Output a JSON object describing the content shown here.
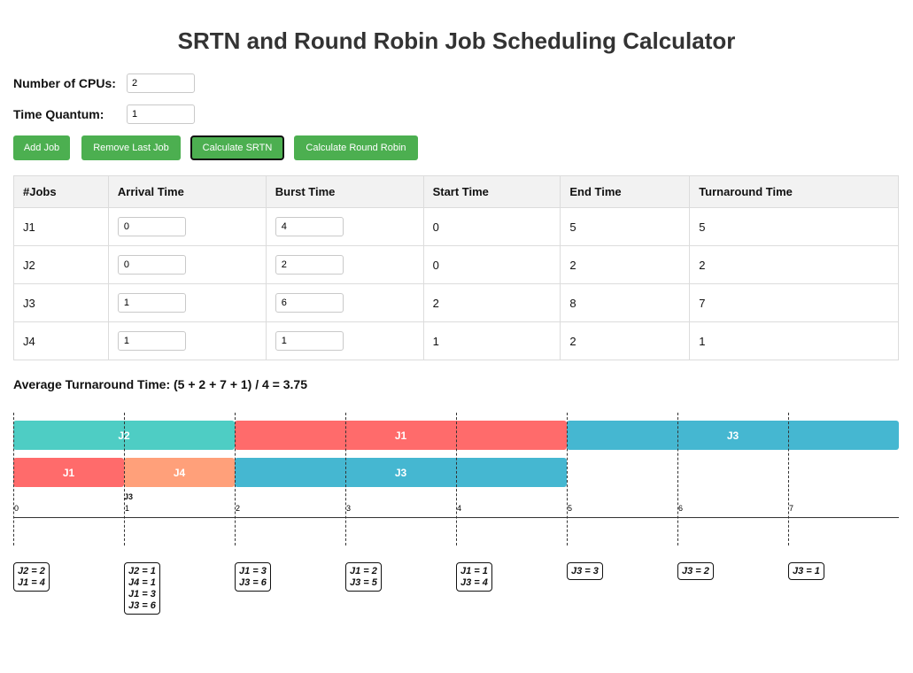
{
  "title": "SRTN and Round Robin Job Scheduling Calculator",
  "settings": {
    "cpus_label": "Number of CPUs:",
    "cpus_value": "2",
    "quantum_label": "Time Quantum:",
    "quantum_value": "1"
  },
  "buttons": {
    "add": "Add Job",
    "remove": "Remove Last Job",
    "srtn": "Calculate SRTN",
    "rr": "Calculate Round Robin"
  },
  "table": {
    "headers": [
      "#Jobs",
      "Arrival Time",
      "Burst Time",
      "Start Time",
      "End Time",
      "Turnaround Time"
    ],
    "rows": [
      {
        "job": "J1",
        "arrival": "0",
        "burst": "4",
        "start": "0",
        "end": "5",
        "turnaround": "5"
      },
      {
        "job": "J2",
        "arrival": "0",
        "burst": "2",
        "start": "0",
        "end": "2",
        "turnaround": "2"
      },
      {
        "job": "J3",
        "arrival": "1",
        "burst": "6",
        "start": "2",
        "end": "8",
        "turnaround": "7"
      },
      {
        "job": "J4",
        "arrival": "1",
        "burst": "1",
        "start": "1",
        "end": "2",
        "turnaround": "1"
      }
    ]
  },
  "average": "Average Turnaround Time: (5 + 2 + 7 + 1) / 4 = 3.75",
  "gantt": {
    "colors": {
      "J1": "#ff6b6b",
      "J2": "#4ecdc4",
      "J3": "#45b7d1",
      "J4": "#ffa07a"
    },
    "cpu1": [
      {
        "job": "J2",
        "start": 0,
        "end": 2
      },
      {
        "job": "J1",
        "start": 2,
        "end": 5
      },
      {
        "job": "J3",
        "start": 5,
        "end": 8
      }
    ],
    "cpu2": [
      {
        "job": "J1",
        "start": 0,
        "end": 1
      },
      {
        "job": "J4",
        "start": 1,
        "end": 2
      },
      {
        "job": "J3",
        "start": 2,
        "end": 5
      }
    ],
    "ticks": [
      "0",
      "1",
      "2",
      "3",
      "4",
      "5",
      "6",
      "7"
    ],
    "arrival_marker": {
      "time": "1",
      "label": "J3"
    },
    "ready_queues": [
      {
        "time": 0,
        "lines": [
          "J2 = 2",
          "J1 = 4"
        ]
      },
      {
        "time": 1,
        "lines": [
          "J2 = 1",
          "J4 = 1",
          "J1 = 3",
          "J3 = 6"
        ]
      },
      {
        "time": 2,
        "lines": [
          "J1 = 3",
          "J3 = 6"
        ]
      },
      {
        "time": 3,
        "lines": [
          "J1 = 2",
          "J3 = 5"
        ]
      },
      {
        "time": 4,
        "lines": [
          "J1 = 1",
          "J3 = 4"
        ]
      },
      {
        "time": 5,
        "lines": [
          "J3 = 3"
        ]
      },
      {
        "time": 6,
        "lines": [
          "J3 = 2"
        ]
      },
      {
        "time": 7,
        "lines": [
          "J3 = 1"
        ]
      }
    ]
  }
}
